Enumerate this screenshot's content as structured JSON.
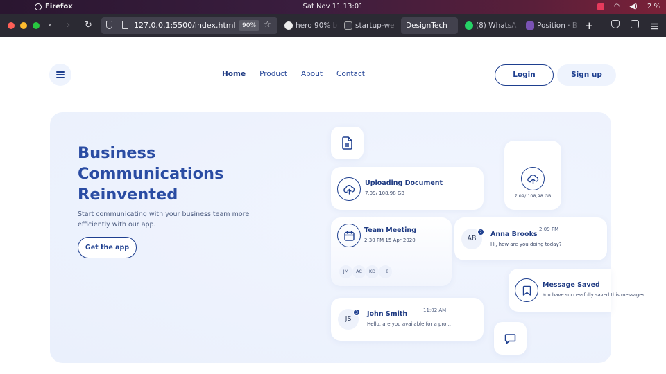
{
  "os": {
    "app_name": "Firefox",
    "clock": "Sat Nov 11  13:01",
    "battery": "2 %",
    "apple_glyph": "",
    "wifi_glyph": "◠",
    "volume_glyph": "◀)"
  },
  "browser": {
    "url": "127.0.0.1:5500/index.html",
    "zoom": "90%",
    "tabs": [
      {
        "label": "hero 90% b",
        "icon": "github-icon"
      },
      {
        "label": "startup-we",
        "icon": "page-icon"
      },
      {
        "label": "DesignTech",
        "active": true
      },
      {
        "label": "(8) WhatsA",
        "icon": "whatsapp-icon"
      },
      {
        "label": "Position · B",
        "icon": "bootstrap-icon"
      }
    ],
    "new_tab": "+",
    "back_glyph": "‹",
    "forward_glyph": "›",
    "reload_glyph": "↻",
    "star_glyph": "☆"
  },
  "nav": {
    "links": [
      "Home",
      "Product",
      "About",
      "Contact"
    ],
    "login": "Login",
    "signup": "Sign up"
  },
  "hero": {
    "title_lines": [
      "Business",
      "Communications",
      "Reinvented"
    ],
    "subtitle": "Start communicating with your business team more efficiently with our app.",
    "cta": "Get the app"
  },
  "cards": {
    "upload": {
      "title": "Uploading Document",
      "size": "7,09/ 108,98 GB"
    },
    "upload_small": {
      "size": "7,09/ 108,98 GB"
    },
    "meeting": {
      "title": "Team Meeting",
      "time": "2:30 PM 15 Apr 2020",
      "attendees": [
        "JM",
        "AC",
        "KD",
        "+8"
      ]
    },
    "anna": {
      "initials": "AB",
      "badge": "2",
      "name": "Anna Brooks",
      "time": "2:09 PM",
      "message": "Hi, how are you doing today?"
    },
    "saved": {
      "title": "Message Saved",
      "message": "You have successfully saved this messages"
    },
    "john": {
      "initials": "JS",
      "badge": "3",
      "name": "John Smith",
      "time": "11:02 AM",
      "message": "Hello, are you available for a pro..."
    }
  },
  "colors": {
    "accent": "#1e3f8f",
    "heading": "#2a4ca3",
    "hero_bg": "#edf2fd"
  }
}
